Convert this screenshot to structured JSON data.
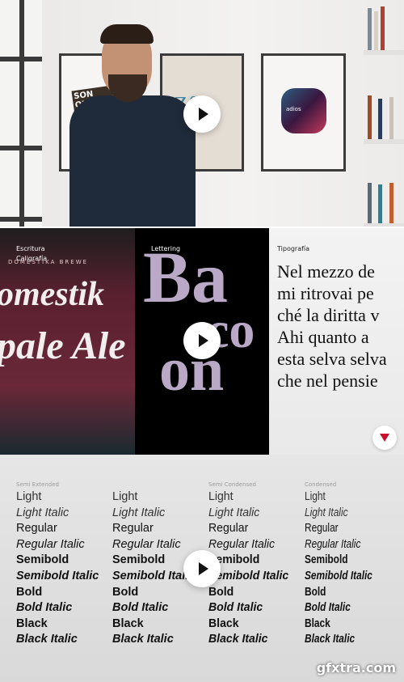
{
  "top_video": {
    "posters": [
      "SON QUATRE",
      "Zf",
      "adios"
    ],
    "play_label": "Play"
  },
  "middle_video": {
    "panels": [
      {
        "labels": [
          "Escritura",
          "Caligrafía"
        ],
        "art_text": [
          "DOMESTIKA BREWE",
          "omestik",
          "pale Ale"
        ]
      },
      {
        "labels": [
          "Lettering"
        ],
        "art_text": [
          "Ba",
          "co",
          "on"
        ]
      },
      {
        "labels": [
          "Tipografía"
        ],
        "lines": [
          "Nel mezzo de",
          "mi ritrovai pe",
          "ché la diritta v",
          "Ahi quanto a",
          "esta selva selva",
          "che nel pensie"
        ]
      }
    ],
    "accent_color": "#c8102e"
  },
  "bottom_video": {
    "columns": [
      {
        "header": "Semi Extended"
      },
      {
        "header": ""
      },
      {
        "header": "Semi Condensed"
      },
      {
        "header": "Condensed"
      }
    ],
    "weights": [
      "Light",
      "Light Italic",
      "Regular",
      "Regular Italic",
      "Semibold",
      "Semibold Italic",
      "Bold",
      "Bold Italic",
      "Black",
      "Black Italic"
    ]
  },
  "watermark": "gfxtra.com"
}
